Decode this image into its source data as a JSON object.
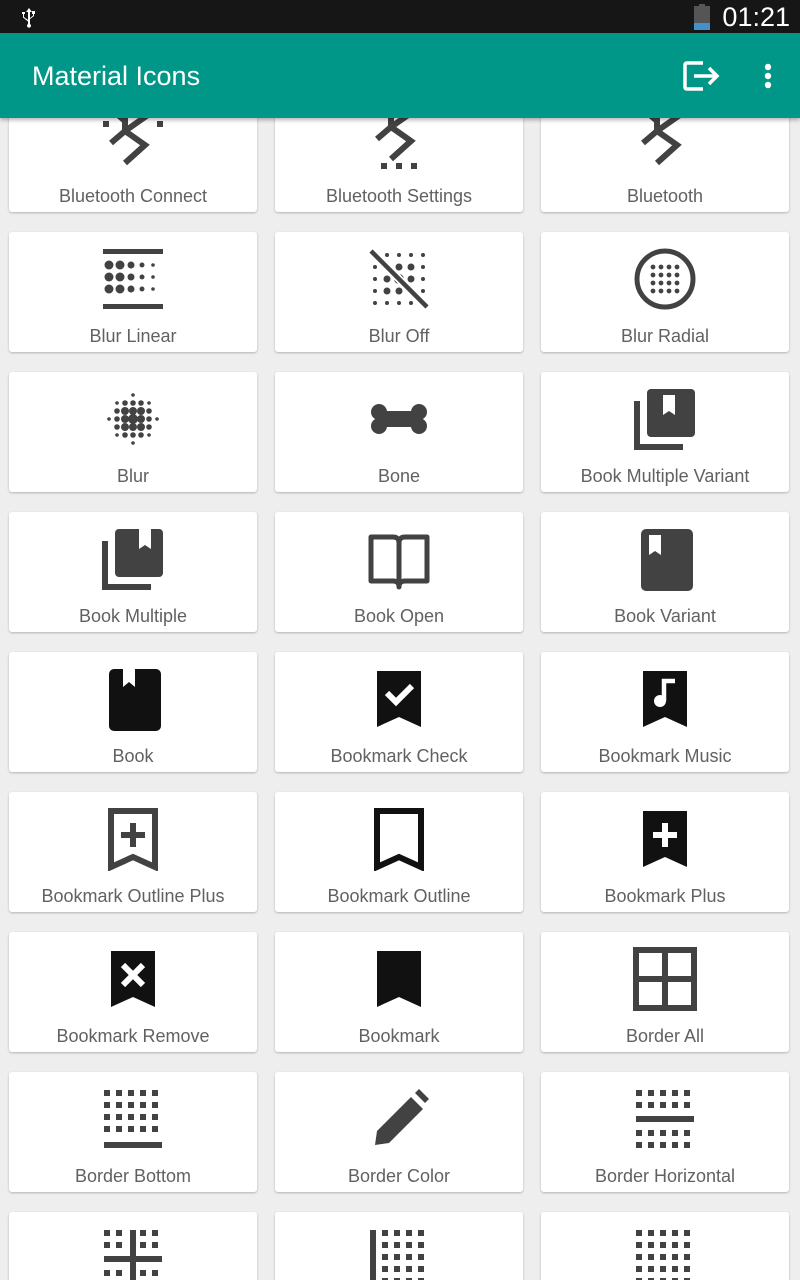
{
  "status_bar": {
    "time": "01:21",
    "icons": [
      "usb-icon",
      "battery-icon"
    ]
  },
  "app_bar": {
    "title": "Material Icons",
    "actions": [
      "export-icon",
      "more-vert-icon"
    ],
    "background": "#009688"
  },
  "icon_color": "#424242",
  "icons": [
    {
      "label": "Bluetooth Connect",
      "icon": "bluetooth-connect-icon"
    },
    {
      "label": "Bluetooth Settings",
      "icon": "bluetooth-settings-icon"
    },
    {
      "label": "Bluetooth",
      "icon": "bluetooth-icon"
    },
    {
      "label": "Blur Linear",
      "icon": "blur-linear-icon"
    },
    {
      "label": "Blur Off",
      "icon": "blur-off-icon"
    },
    {
      "label": "Blur Radial",
      "icon": "blur-radial-icon"
    },
    {
      "label": "Blur",
      "icon": "blur-icon"
    },
    {
      "label": "Bone",
      "icon": "bone-icon"
    },
    {
      "label": "Book Multiple Variant",
      "icon": "book-multiple-variant-icon"
    },
    {
      "label": "Book Multiple",
      "icon": "book-multiple-icon"
    },
    {
      "label": "Book Open",
      "icon": "book-open-icon"
    },
    {
      "label": "Book Variant",
      "icon": "book-variant-icon"
    },
    {
      "label": "Book",
      "icon": "book-icon"
    },
    {
      "label": "Bookmark Check",
      "icon": "bookmark-check-icon"
    },
    {
      "label": "Bookmark Music",
      "icon": "bookmark-music-icon"
    },
    {
      "label": "Bookmark Outline Plus",
      "icon": "bookmark-outline-plus-icon"
    },
    {
      "label": "Bookmark Outline",
      "icon": "bookmark-outline-icon"
    },
    {
      "label": "Bookmark Plus",
      "icon": "bookmark-plus-icon"
    },
    {
      "label": "Bookmark Remove",
      "icon": "bookmark-remove-icon"
    },
    {
      "label": "Bookmark",
      "icon": "bookmark-icon"
    },
    {
      "label": "Border All",
      "icon": "border-all-icon"
    },
    {
      "label": "Border Bottom",
      "icon": "border-bottom-icon"
    },
    {
      "label": "Border Color",
      "icon": "border-color-icon"
    },
    {
      "label": "Border Horizontal",
      "icon": "border-horizontal-icon"
    },
    {
      "label": "",
      "icon": "border-inside-icon"
    },
    {
      "label": "",
      "icon": "border-left-icon"
    },
    {
      "label": "",
      "icon": "border-none-icon"
    }
  ]
}
